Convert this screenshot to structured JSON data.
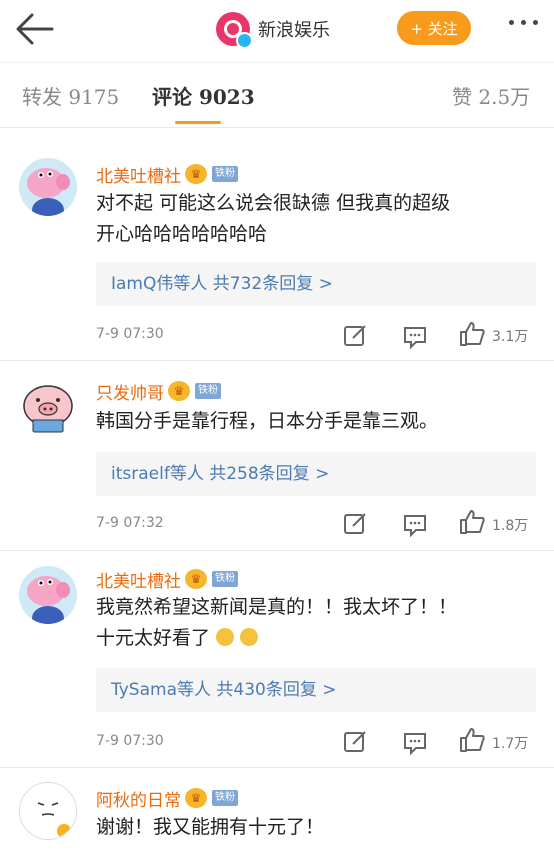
{
  "header": {
    "account_name": "新浪娱乐",
    "follow_label": "+ 关注"
  },
  "tabs": [
    {
      "label": "转发 9175"
    },
    {
      "label": "评论 9023"
    },
    {
      "label": "赞 2.5万"
    }
  ],
  "comments": [
    {
      "user": "北美吐槽社",
      "badge": "铁粉",
      "text_lines": [
        "对不起 可能这么说会很缺德 但我真的超级",
        "开心哈哈哈哈哈哈哈"
      ],
      "reply": "IamQ伟等人 共732条回复 >",
      "time": "7-9 07:30",
      "likes": "3.1万"
    },
    {
      "user": "只发帅哥",
      "badge": "铁粉",
      "text_lines": [
        "韩国分手是靠行程，日本分手是靠三观。"
      ],
      "reply": "itsraelf等人 共258条回复 >",
      "time": "7-9 07:32",
      "likes": "1.8万"
    },
    {
      "user": "北美吐槽社",
      "badge": "铁粉",
      "text_lines": [
        "我竟然希望这新闻是真的！！我太坏了！！",
        "十元太好看了"
      ],
      "reply": "TySama等人 共430条回复 >",
      "time": "7-9 07:30",
      "likes": "1.7万"
    },
    {
      "user": "阿秋的日常",
      "badge": "铁粉",
      "text_lines": [
        "谢谢！我又能拥有十元了！"
      ]
    }
  ]
}
